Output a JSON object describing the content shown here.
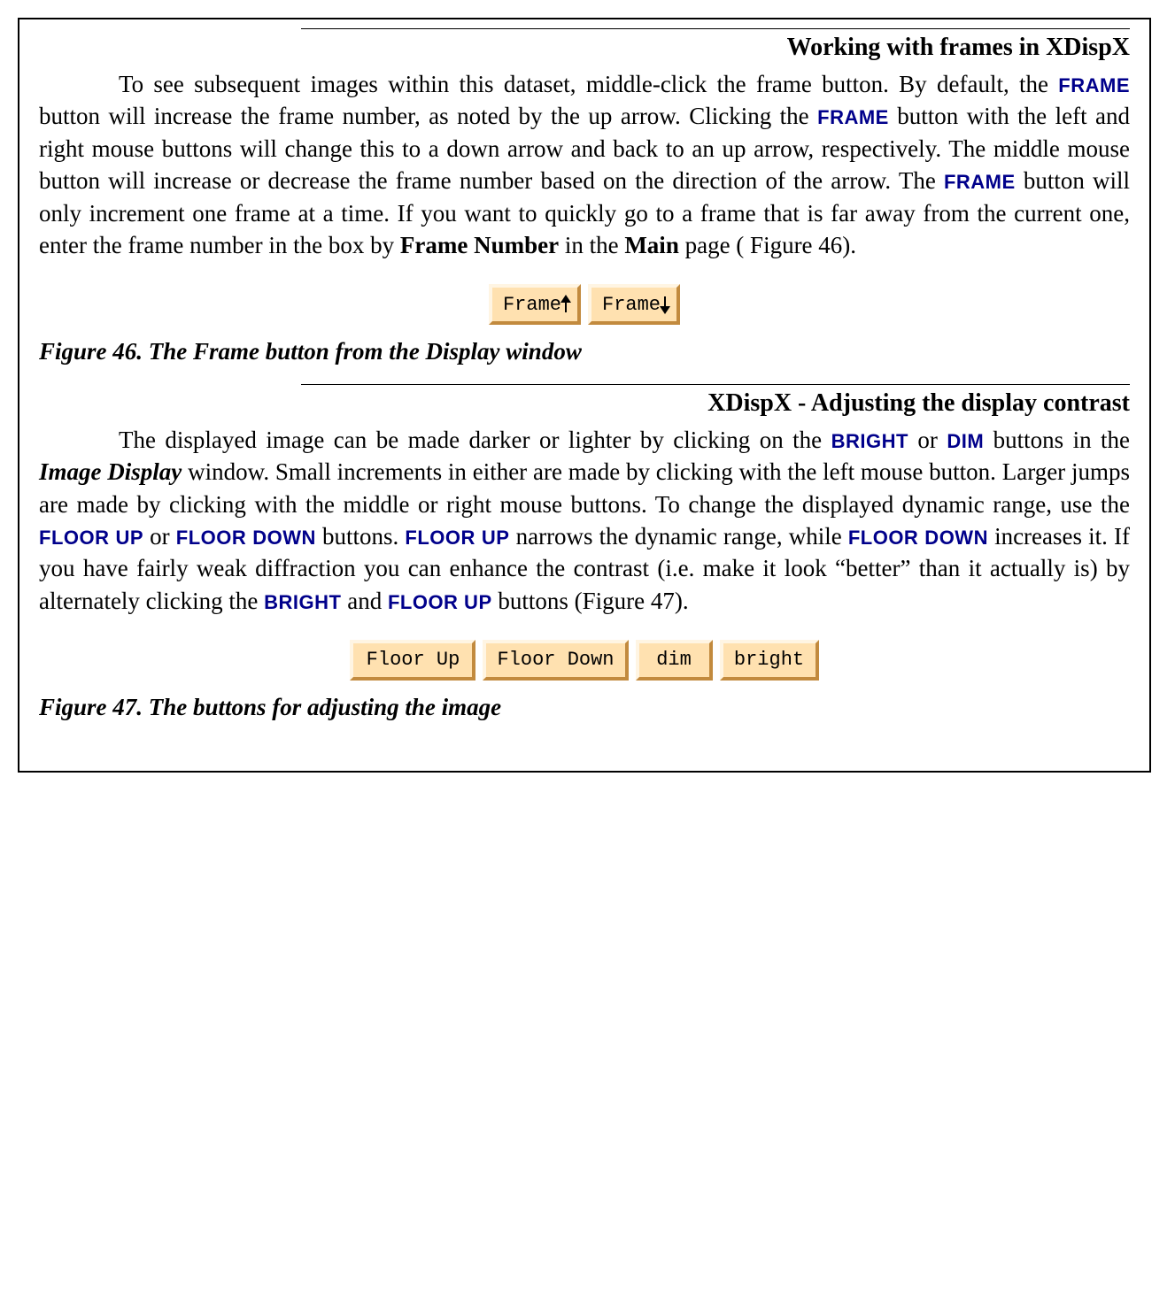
{
  "section1": {
    "heading": "Working with frames in XDispX",
    "para_a": "To see subsequent images within this dataset, middle-click the frame button. By default, the ",
    "kw1": "FRAME",
    "para_b": " button will increase the frame number, as noted by the up arrow. Clicking the ",
    "kw2": "FRAME",
    "para_c": " button with the left and right mouse buttons will change this to a down arrow and back to an up arrow, respectively.  The middle mouse button will increase or decrease the frame number based on the direction of the arrow. The ",
    "kw3": "FRAME",
    "para_d": " button will only increment one frame at a time. If you want to quickly go to a frame that is far away from the current one, enter the frame number in the box by ",
    "bold1": "Frame Number",
    "para_e": " in the ",
    "bold2": "Main",
    "para_f": " page ( Figure 46)."
  },
  "fig46": {
    "btn_frame_up": "Frame",
    "btn_frame_down": "Frame",
    "caption": "Figure 46. The Frame button from the Display window"
  },
  "section2": {
    "heading": "XDispX - Adjusting the display contrast",
    "para_a": "The displayed image can be made darker or lighter by clicking on the ",
    "kw_bright1": "BRIGHT",
    "para_b": " or ",
    "kw_dim": "DIM",
    "para_c": " buttons in the ",
    "bi1": "Image Display",
    "para_d": " window. Small increments in either are made by clicking with the left mouse button. Larger jumps are made by clicking with the middle or right mouse buttons. To change the displayed dynamic range, use the ",
    "kw_fu1": "FLOOR UP",
    "para_e": " or ",
    "kw_fd1": "FLOOR DOWN",
    "para_f": " buttons. ",
    "kw_fu2": "FLOOR UP",
    "para_g": " narrows the dynamic range, while ",
    "kw_fd2": "FLOOR DOWN",
    "para_h": " increases it. If you have fairly weak diffraction you can enhance the contrast (i.e. make it look “better” than it actually is) by alternately clicking the ",
    "kw_bright2": "BRIGHT",
    "para_i": " and ",
    "kw_fu3": "FLOOR UP",
    "para_j": " buttons (Figure 47)."
  },
  "fig47": {
    "btn_floor_up": "Floor Up",
    "btn_floor_down": "Floor Down",
    "btn_dim": "dim",
    "btn_bright": "bright",
    "caption": "Figure 47. The buttons for adjusting the image"
  }
}
